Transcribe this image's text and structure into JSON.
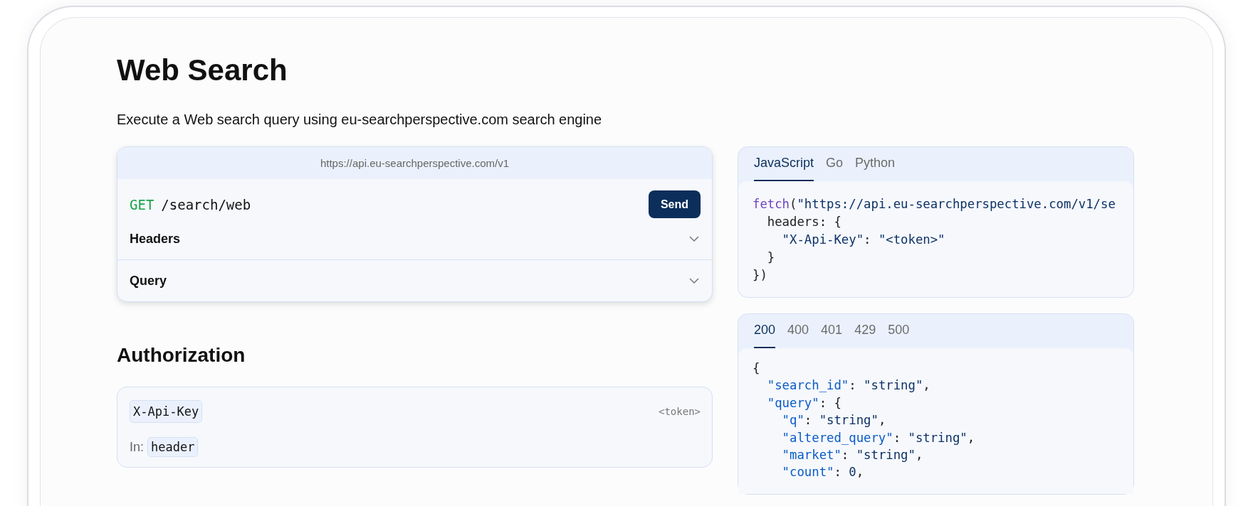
{
  "title": "Web Search",
  "description": "Execute a Web search query using eu-searchperspective.com search engine",
  "request": {
    "base_url": "https://api.eu-searchperspective.com/v1",
    "method": "GET",
    "path": "/search/web",
    "send_label": "Send",
    "sections": [
      {
        "label": "Headers",
        "expanded": false
      },
      {
        "label": "Query",
        "expanded": false
      }
    ]
  },
  "authorization": {
    "heading": "Authorization",
    "name": "X-Api-Key",
    "value": "<token>",
    "in_label": "In:",
    "in_value": "header"
  },
  "code_panel": {
    "tabs": [
      {
        "label": "JavaScript",
        "selected": true
      },
      {
        "label": "Go",
        "selected": false
      },
      {
        "label": "Python",
        "selected": false
      }
    ],
    "lines": [
      [
        {
          "kind": "fn",
          "text": "fetch"
        },
        {
          "kind": "punct",
          "text": "("
        },
        {
          "kind": "str",
          "text": "\"https://api.eu-searchperspective.com/v1/se"
        }
      ],
      [
        {
          "kind": "punct",
          "text": "  headers: {"
        }
      ],
      [
        {
          "kind": "str",
          "text": "    \"X-Api-Key\""
        },
        {
          "kind": "punct",
          "text": ": "
        },
        {
          "kind": "str",
          "text": "\"<token>\""
        }
      ],
      [
        {
          "kind": "punct",
          "text": "  }"
        }
      ],
      [
        {
          "kind": "punct",
          "text": "})"
        }
      ]
    ]
  },
  "response_panel": {
    "tabs": [
      {
        "label": "200",
        "selected": true
      },
      {
        "label": "400",
        "selected": false
      },
      {
        "label": "401",
        "selected": false
      },
      {
        "label": "429",
        "selected": false
      },
      {
        "label": "500",
        "selected": false
      }
    ],
    "lines": [
      [
        {
          "kind": "punct",
          "text": "{"
        }
      ],
      [
        {
          "kind": "key",
          "text": "  \"search_id\""
        },
        {
          "kind": "punct",
          "text": ": "
        },
        {
          "kind": "str",
          "text": "\"string\""
        },
        {
          "kind": "punct",
          "text": ","
        }
      ],
      [
        {
          "kind": "key",
          "text": "  \"query\""
        },
        {
          "kind": "punct",
          "text": ": {"
        }
      ],
      [
        {
          "kind": "key",
          "text": "    \"q\""
        },
        {
          "kind": "punct",
          "text": ": "
        },
        {
          "kind": "str",
          "text": "\"string\""
        },
        {
          "kind": "punct",
          "text": ","
        }
      ],
      [
        {
          "kind": "key",
          "text": "    \"altered_query\""
        },
        {
          "kind": "punct",
          "text": ": "
        },
        {
          "kind": "str",
          "text": "\"string\""
        },
        {
          "kind": "punct",
          "text": ","
        }
      ],
      [
        {
          "kind": "key",
          "text": "    \"market\""
        },
        {
          "kind": "punct",
          "text": ": "
        },
        {
          "kind": "str",
          "text": "\"string\""
        },
        {
          "kind": "punct",
          "text": ","
        }
      ],
      [
        {
          "kind": "key",
          "text": "    \"count\""
        },
        {
          "kind": "punct",
          "text": ": "
        },
        {
          "kind": "str",
          "text": "0"
        },
        {
          "kind": "punct",
          "text": ","
        }
      ]
    ]
  }
}
